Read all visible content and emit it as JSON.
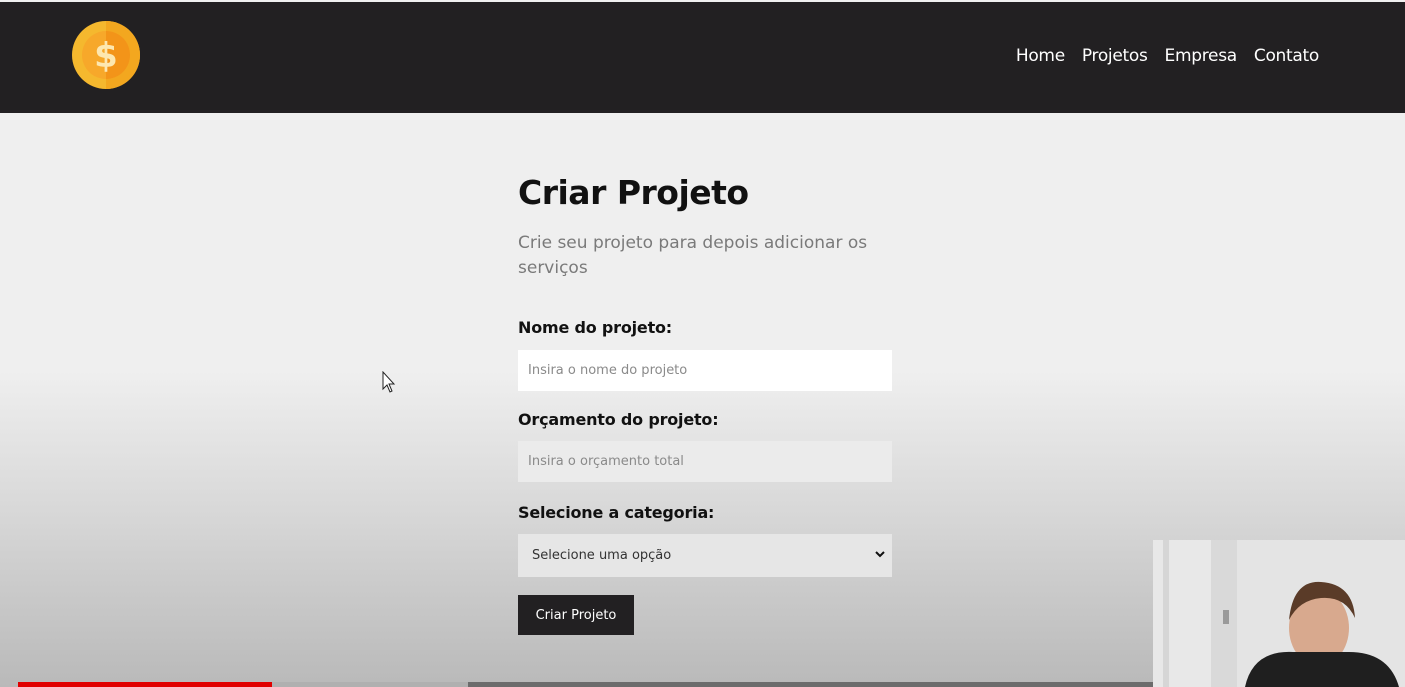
{
  "nav": {
    "items": [
      {
        "label": "Home"
      },
      {
        "label": "Projetos"
      },
      {
        "label": "Empresa"
      },
      {
        "label": "Contato"
      }
    ]
  },
  "logo": {
    "icon": "dollar-coin-icon",
    "color": "#f5b82e"
  },
  "page": {
    "title": "Criar Projeto",
    "subtitle": "Crie seu projeto para depois adicionar os serviços"
  },
  "form": {
    "name_label": "Nome do projeto:",
    "name_placeholder": "Insira o nome do projeto",
    "budget_label": "Orçamento do projeto:",
    "budget_placeholder": "Insira o orçamento total",
    "category_label": "Selecione a categoria:",
    "category_selected": "Selecione uma opção",
    "submit_label": "Criar Projeto"
  },
  "video": {
    "progress": 0.22,
    "accent": "#e00000"
  }
}
